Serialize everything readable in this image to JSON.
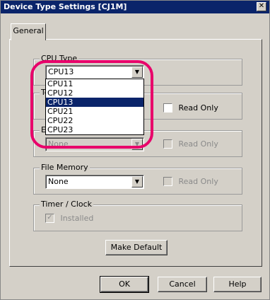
{
  "window": {
    "title": "Device Type Settings [CJ1M]",
    "close_glyph": "✕"
  },
  "tabs": [
    {
      "label": "General"
    }
  ],
  "cpu_type": {
    "legend": "CPU Type",
    "selected": "CPU13",
    "options": [
      "CPU11",
      "CPU12",
      "CPU13",
      "CPU21",
      "CPU22",
      "CPU23"
    ],
    "selected_index": 2
  },
  "group2": {
    "legend_fragment": "To",
    "read_only_label": "Read Only",
    "read_only_checked": false
  },
  "group3": {
    "legend_fragment": "Ex",
    "value": "None",
    "read_only_label": "Read Only",
    "read_only_checked": false,
    "enabled": false
  },
  "file_memory": {
    "legend": "File Memory",
    "value": "None",
    "read_only_label": "Read Only",
    "read_only_checked": false
  },
  "timer_clock": {
    "legend": "Timer / Clock",
    "installed_label": "Installed",
    "installed_checked": true,
    "enabled": false
  },
  "buttons": {
    "make_default": "Make Default",
    "ok": "OK",
    "cancel": "Cancel",
    "help": "Help"
  },
  "icons": {
    "dropdown_arrow": "▼",
    "check": "✓"
  },
  "colors": {
    "title_bar": "#0a246a",
    "selection": "#0a246a",
    "highlight_ring": "#e8006a",
    "face": "#d4d0c8"
  }
}
